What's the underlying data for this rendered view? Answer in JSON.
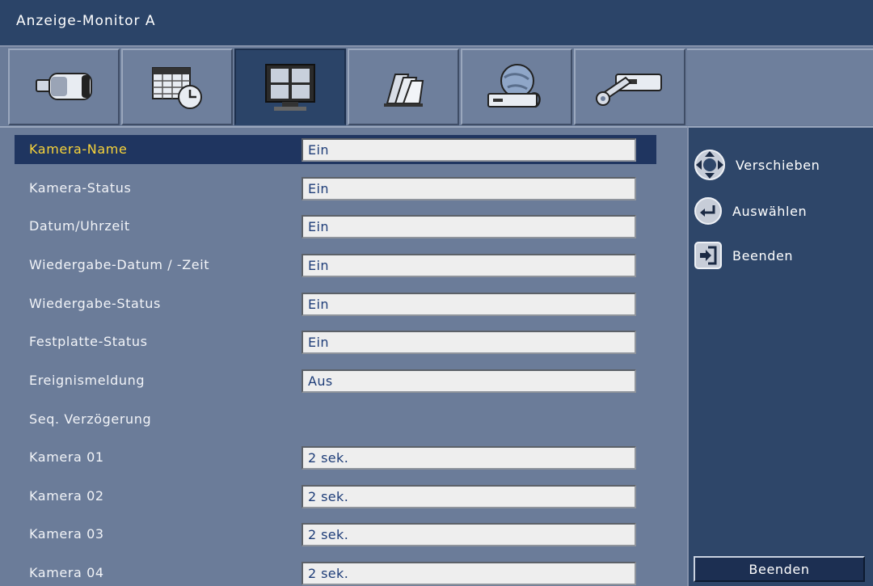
{
  "window": {
    "title": "Anzeige-Monitor A"
  },
  "tabs": [
    {
      "icon": "camera-icon"
    },
    {
      "icon": "schedule-icon"
    },
    {
      "icon": "monitor-icon",
      "active": true
    },
    {
      "icon": "alarm-icon"
    },
    {
      "icon": "network-icon"
    },
    {
      "icon": "system-tools-icon"
    }
  ],
  "settings": [
    {
      "label": "Kamera-Name",
      "value": "Ein",
      "selected": true
    },
    {
      "label": "Kamera-Status",
      "value": "Ein"
    },
    {
      "label": "Datum/Uhrzeit",
      "value": "Ein"
    },
    {
      "label": "Wiedergabe-Datum / -Zeit",
      "value": "Ein"
    },
    {
      "label": "Wiedergabe-Status",
      "value": "Ein"
    },
    {
      "label": "Festplatte-Status",
      "value": "Ein"
    },
    {
      "label": "Ereignismeldung",
      "value": "Aus"
    }
  ],
  "sequence": {
    "heading": "Seq. Verzögerung",
    "cameras": [
      {
        "label": "Kamera 01",
        "value": "2 sek."
      },
      {
        "label": "Kamera 02",
        "value": "2 sek."
      },
      {
        "label": "Kamera 03",
        "value": "2 sek."
      },
      {
        "label": "Kamera 04",
        "value": "2 sek."
      }
    ]
  },
  "help": {
    "move_label": "Verschieben",
    "select_label": "Auswählen",
    "exit_label": "Beenden"
  },
  "footer": {
    "exit_button": "Beenden"
  },
  "colors": {
    "highlight_text": "#f8d43a",
    "selected_row": "#1f3560",
    "panel": "#6b7c99"
  }
}
